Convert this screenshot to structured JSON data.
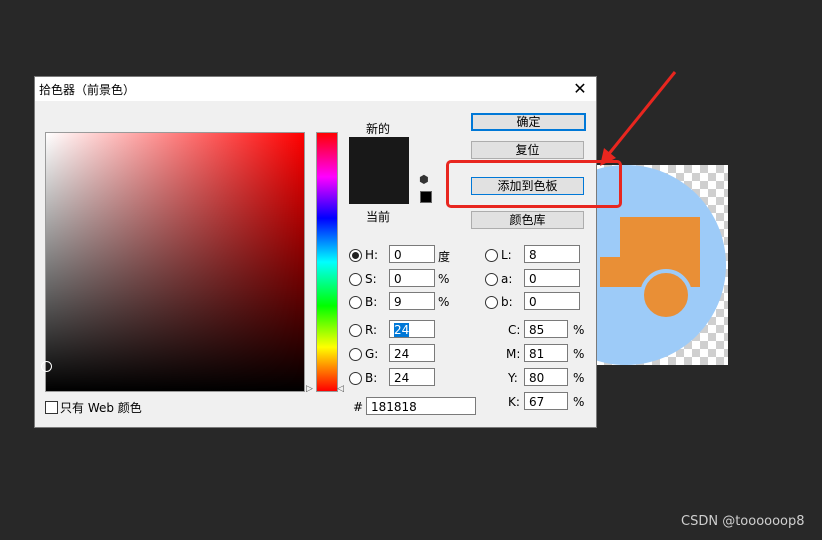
{
  "dialog": {
    "title": "拾色器（前景色）",
    "close": "✕",
    "new_label": "新的",
    "current_label": "当前",
    "web_only_label": "只有 Web 颜色",
    "buttons": {
      "ok": "确定",
      "reset": "复位",
      "add_to_swatches": "添加到色板",
      "color_libraries": "颜色库"
    },
    "hsb": [
      {
        "label": "H:",
        "value": "0",
        "unit": "度",
        "selected": true
      },
      {
        "label": "S:",
        "value": "0",
        "unit": "%",
        "selected": false
      },
      {
        "label": "B:",
        "value": "9",
        "unit": "%",
        "selected": false
      }
    ],
    "rgb": [
      {
        "label": "R:",
        "value": "24"
      },
      {
        "label": "G:",
        "value": "24"
      },
      {
        "label": "B:",
        "value": "24"
      }
    ],
    "lab": [
      {
        "label": "L:",
        "value": "8"
      },
      {
        "label": "a:",
        "value": "0"
      },
      {
        "label": "b:",
        "value": "0"
      }
    ],
    "cmyk": [
      {
        "label": "C:",
        "value": "85",
        "unit": "%"
      },
      {
        "label": "M:",
        "value": "81",
        "unit": "%"
      },
      {
        "label": "Y:",
        "value": "80",
        "unit": "%"
      },
      {
        "label": "K:",
        "value": "67",
        "unit": "%"
      }
    ],
    "hex_label": "#",
    "hex_value": "181818",
    "icons": {
      "gamut": "cube-icon"
    }
  },
  "colors": {
    "selected": "#181818",
    "annotation": "#e8261f",
    "accent": "#0078d7"
  },
  "watermark": "CSDN @toooooop8"
}
